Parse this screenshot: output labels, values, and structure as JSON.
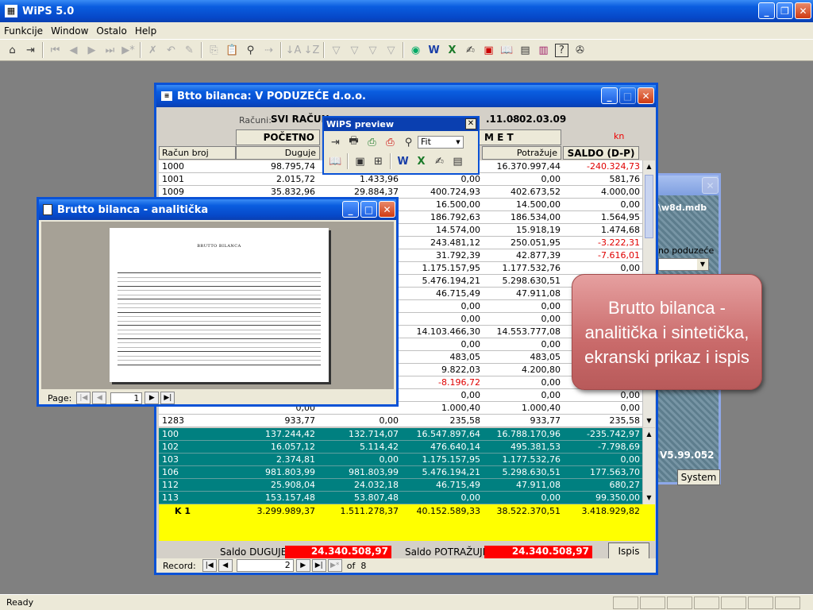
{
  "app": {
    "title": "WiPS 5.0"
  },
  "menu": [
    "Funkcije",
    "Window",
    "Ostalo",
    "Help"
  ],
  "status": {
    "text": "Ready"
  },
  "bilanca": {
    "title": "Btto bilanca: V PODUZEĆE d.o.o.",
    "racuni_label": "Računi:",
    "racuni_value": "SVI RAČUN",
    "date_from": ".11.08",
    "date_to": "02.03.09",
    "dash": "-",
    "pocetno": "POČETNO",
    "promet": "M E T",
    "currency": "kn",
    "col_racun": "Račun broj",
    "col_duguje": "Duguje",
    "col_potrazuje": "Potražuje",
    "col_saldo": "SALDO (D-P)",
    "rows": [
      {
        "r": "1000",
        "a": "98.795,74",
        "b": "",
        "c": "",
        "d": "16.370.997,44",
        "s": "-240.324,73",
        "neg": true
      },
      {
        "r": "1001",
        "a": "2.015,72",
        "b": "1.433,96",
        "c": "0,00",
        "d": "0,00",
        "s": "581,76"
      },
      {
        "r": "1009",
        "a": "35.832,96",
        "b": "29.884,37",
        "c": "400.724,93",
        "d": "402.673,52",
        "s": "4.000,00"
      },
      {
        "r": "",
        "a": "",
        "b": "",
        "c": "16.500,00",
        "d": "14.500,00",
        "s": "0,00"
      },
      {
        "r": "",
        "a": "",
        "b": "",
        "c": "186.792,63",
        "d": "186.534,00",
        "s": "1.564,95"
      },
      {
        "r": "",
        "a": "",
        "b": "",
        "c": "14.574,00",
        "d": "15.918,19",
        "s": "1.474,68"
      },
      {
        "r": "",
        "a": "",
        "b": "",
        "c": "243.481,12",
        "d": "250.051,95",
        "s": "-3.222,31",
        "neg": true
      },
      {
        "r": "",
        "a": "",
        "b": "",
        "c": "31.792,39",
        "d": "42.877,39",
        "s": "-7.616,01",
        "neg": true
      },
      {
        "r": "",
        "a": "",
        "b": "",
        "c": "1.175.157,95",
        "d": "1.177.532,76",
        "s": "0,00"
      },
      {
        "r": "",
        "a": "",
        "b": "",
        "c": "5.476.194,21",
        "d": "5.298.630,51",
        "s": ""
      },
      {
        "r": "",
        "a": "",
        "b": "",
        "c": "46.715,49",
        "d": "47.911,08",
        "s": ""
      },
      {
        "r": "",
        "a": "",
        "b": "",
        "c": "0,00",
        "d": "0,00",
        "s": ""
      },
      {
        "r": "",
        "a": "",
        "b": "",
        "c": "0,00",
        "d": "0,00",
        "s": ""
      },
      {
        "r": "",
        "a": "",
        "b": "",
        "c": "14.103.466,30",
        "d": "14.553.777,08",
        "s": ""
      },
      {
        "r": "",
        "a": "",
        "b": "",
        "c": "0,00",
        "d": "0,00",
        "s": ""
      },
      {
        "r": "",
        "a": "",
        "b": "",
        "c": "483,05",
        "d": "483,05",
        "s": ""
      },
      {
        "r": "",
        "a": "",
        "b": "",
        "c": "9.822,03",
        "d": "4.200,80",
        "s": ""
      },
      {
        "r": "",
        "a": "",
        "b": "",
        "c": "-8.196,72",
        "d": "0,00",
        "s": "",
        "cneg": true
      },
      {
        "r": "",
        "a": "",
        "b": "",
        "c": "0,00",
        "d": "0,00",
        "s": "0,00"
      },
      {
        "r": "",
        "a": "0,00",
        "b": "",
        "c": "1.000,40",
        "d": "1.000,40",
        "s": "0,00"
      },
      {
        "r": "1283",
        "a": "933,77",
        "b": "0,00",
        "c": "235,58",
        "d": "933,77",
        "s": "235,58"
      }
    ],
    "teal_rows": [
      {
        "r": "100",
        "a": "137.244,42",
        "b": "132.714,07",
        "c": "16.547.897,64",
        "d": "16.788.170,96",
        "s": "-235.742,97"
      },
      {
        "r": "102",
        "a": "16.057,12",
        "b": "5.114,42",
        "c": "476.640,14",
        "d": "495.381,53",
        "s": "-7.798,69"
      },
      {
        "r": "103",
        "a": "2.374,81",
        "b": "0,00",
        "c": "1.175.157,95",
        "d": "1.177.532,76",
        "s": "0,00"
      },
      {
        "r": "106",
        "a": "981.803,99",
        "b": "981.803,99",
        "c": "5.476.194,21",
        "d": "5.298.630,51",
        "s": "177.563,70"
      },
      {
        "r": "112",
        "a": "25.908,04",
        "b": "24.032,18",
        "c": "46.715,49",
        "d": "47.911,08",
        "s": "680,27"
      },
      {
        "r": "113",
        "a": "153.157,48",
        "b": "53.807,48",
        "c": "0,00",
        "d": "0,00",
        "s": "99.350,00"
      }
    ],
    "total": {
      "r": "K    1",
      "a": "3.299.989,37",
      "b": "1.511.278,37",
      "c": "40.152.589,33",
      "d": "38.522.370,51",
      "s": "3.418.929,82"
    },
    "saldo_duguje_label": "Saldo DUGUJE",
    "saldo_duguje": "24.340.508,97",
    "saldo_potrazuje_label": "Saldo POTRAŽUJE",
    "saldo_potrazuje": "24.340.508,97",
    "ispis": "Ispis",
    "record_label": "Record:",
    "record_value": "2",
    "record_of": "of  8"
  },
  "preview_toolbar": {
    "title": "WiPS preview",
    "zoom": "Fit"
  },
  "analiticka": {
    "title": "Brutto bilanca - analitička",
    "page_label": "Page:",
    "page_value": "1",
    "doc_title": "BRUTTO BILANCA"
  },
  "back_window": {
    "path": "\\w8d.mdb",
    "company": "no poduzeće",
    "version": "V5.99.052",
    "system_btn": "System"
  },
  "callout": {
    "text": "Brutto bilanca - analitička i sintetička, ekranski prikaz i ispis"
  }
}
